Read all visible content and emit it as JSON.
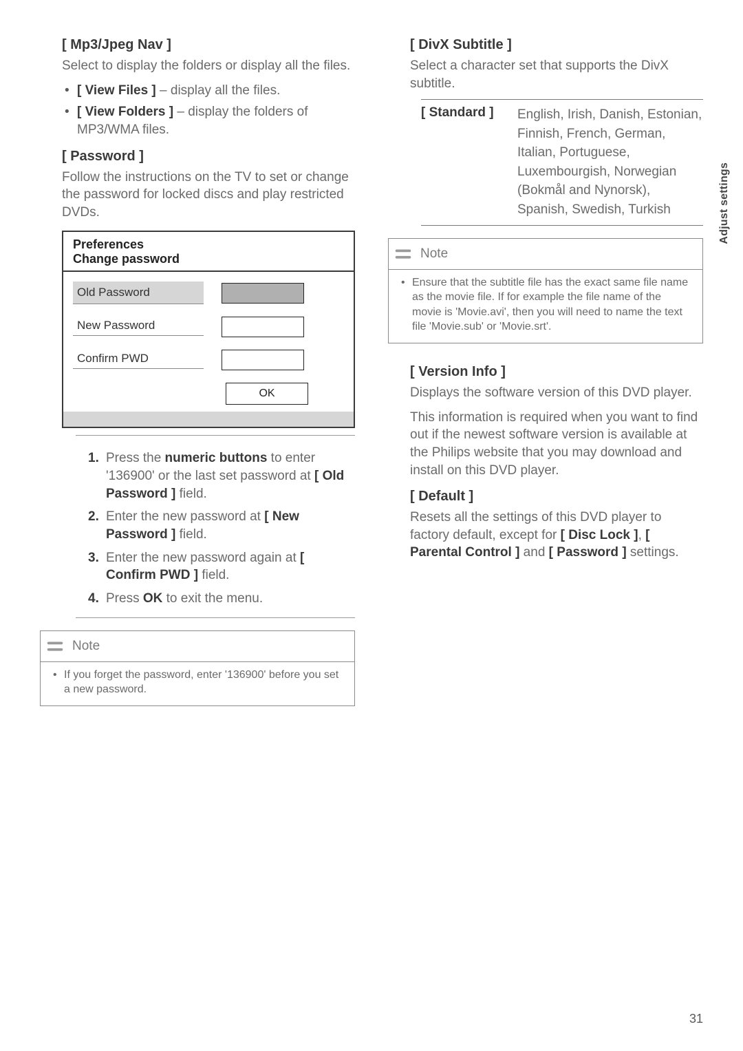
{
  "left": {
    "mp3_title": "[ Mp3/Jpeg Nav ]",
    "mp3_body": "Select to display the folders or display all the files.",
    "view_files_label": "[ View Files ]",
    "view_files_rest": " – display all the files.",
    "view_folders_label": "[ View Folders ]",
    "view_folders_rest": " – display the folders of MP3/WMA files.",
    "pass_title": "[ Password ]",
    "pass_body": "Follow the instructions on the TV to set or change the password for locked discs and play restricted DVDs.",
    "pref": {
      "title": "Preferences",
      "subtitle": "Change password",
      "old_label": "Old Password",
      "new_label": "New Password",
      "confirm_label": "Confirm PWD",
      "ok": "OK"
    },
    "steps": {
      "s1a": "Press the ",
      "s1b": "numeric buttons",
      "s1c": " to enter '136900' or the last set password at ",
      "s1d": "[ Old Password ]",
      "s1e": " field.",
      "s2a": "Enter the new password at ",
      "s2b": "[ New Password ]",
      "s2c": " field.",
      "s3a": "Enter the new password again at ",
      "s3b": "[ Confirm PWD ]",
      "s3c": " field.",
      "s4a": "Press ",
      "s4b": "OK",
      "s4c": " to exit the menu."
    },
    "note_title": "Note",
    "note_body": "If you forget the password, enter '136900' before you set a new password."
  },
  "right": {
    "divx_title": "[ DivX Subtitle ]",
    "divx_body": "Select a character set that supports the DivX subtitle.",
    "standard_key": "[ Standard ]",
    "standard_val": "English, Irish, Danish, Estonian, Finnish, French, German, Italian, Portuguese, Luxembourgish, Norwegian (Bokmål and Nynorsk), Spanish, Swedish, Turkish",
    "note_title": "Note",
    "note_body": "Ensure that the subtitle file has the exact same file name as the movie file. If for example the file name of the movie is 'Movie.avi', then you will need to name the text file 'Movie.sub' or 'Movie.srt'.",
    "version_title": "[ Version Info ]",
    "version_body1": "Displays the software version of this DVD player.",
    "version_body2": "This information is required when you want to find out if the newest software version is available at the Philips website that you may download and install on this DVD player.",
    "default_title": "[ Default ]",
    "default_a": "Resets all the settings of this DVD player to factory default, except for ",
    "default_b": "[ Disc Lock ]",
    "default_c": ", ",
    "default_d": "[ Parental Control ]",
    "default_e": " and ",
    "default_f": "[ Password ]",
    "default_g": " settings."
  },
  "side_label": "Adjust settings",
  "page_num": "31"
}
